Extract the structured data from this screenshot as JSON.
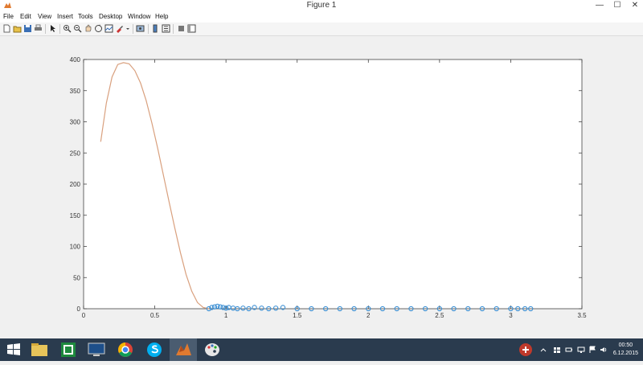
{
  "window": {
    "title": "Figure 1",
    "minimize": "—",
    "maximize": "☐",
    "close": "✕"
  },
  "menu": [
    "File",
    "Edit",
    "View",
    "Insert",
    "Tools",
    "Desktop",
    "Window",
    "Help"
  ],
  "toolbar": {
    "icons": [
      "new-figure-icon",
      "open-file-icon",
      "save-icon",
      "print-icon",
      "pointer-icon",
      "zoom-in-icon",
      "zoom-out-icon",
      "pan-icon",
      "rotate-3d-icon",
      "data-cursor-icon",
      "brush-icon",
      "link-plot-icon",
      "colorbar-icon",
      "legend-icon",
      "hide-plot-tools-icon",
      "show-plot-tools-icon"
    ]
  },
  "chart_data": {
    "type": "line",
    "title": "",
    "xlabel": "",
    "ylabel": "",
    "xlim": [
      0,
      3.5
    ],
    "ylim": [
      0,
      400
    ],
    "xticks": [
      "0",
      "0.5",
      "1",
      "1.5",
      "2",
      "2.5",
      "3",
      "3.5"
    ],
    "yticks": [
      "0",
      "50",
      "100",
      "150",
      "200",
      "250",
      "300",
      "350",
      "400"
    ],
    "grid": false,
    "series": [
      {
        "color": "#d9a07e",
        "style": "line",
        "x": [
          0.12,
          0.16,
          0.2,
          0.24,
          0.28,
          0.32,
          0.36,
          0.4,
          0.44,
          0.48,
          0.52,
          0.56,
          0.6,
          0.64,
          0.68,
          0.72,
          0.76,
          0.8,
          0.84,
          0.88
        ],
        "y": [
          268,
          330,
          372,
          392,
          395,
          393,
          382,
          362,
          334,
          298,
          258,
          215,
          172,
          130,
          90,
          55,
          28,
          10,
          2,
          0
        ]
      },
      {
        "color": "#3b8fd4",
        "style": "markers",
        "x": [
          0.88,
          0.9,
          0.92,
          0.94,
          0.96,
          0.98,
          1.0,
          1.02,
          1.05,
          1.08,
          1.12,
          1.16,
          1.2,
          1.25,
          1.3,
          1.35,
          1.4,
          1.5,
          1.6,
          1.7,
          1.8,
          1.9,
          2.0,
          2.1,
          2.2,
          2.3,
          2.4,
          2.5,
          2.6,
          2.7,
          2.8,
          2.9,
          3.0,
          3.05,
          3.1,
          3.14
        ],
        "y": [
          0,
          2,
          3,
          4,
          3,
          2,
          1,
          2,
          1,
          0,
          1,
          0,
          2,
          1,
          0,
          1,
          2,
          0,
          0,
          0,
          0,
          0,
          0,
          0,
          0,
          0,
          0,
          0,
          0,
          0,
          0,
          0,
          0,
          0,
          0,
          0
        ]
      }
    ]
  },
  "taskbar": {
    "apps": [
      "windows-start-icon",
      "file-explorer-icon",
      "spreadsheet-app-icon",
      "remote-desktop-icon",
      "chrome-icon",
      "skype-icon",
      "matlab-icon",
      "paint-icon"
    ],
    "time": "00:50",
    "date": "6.12.2015"
  }
}
